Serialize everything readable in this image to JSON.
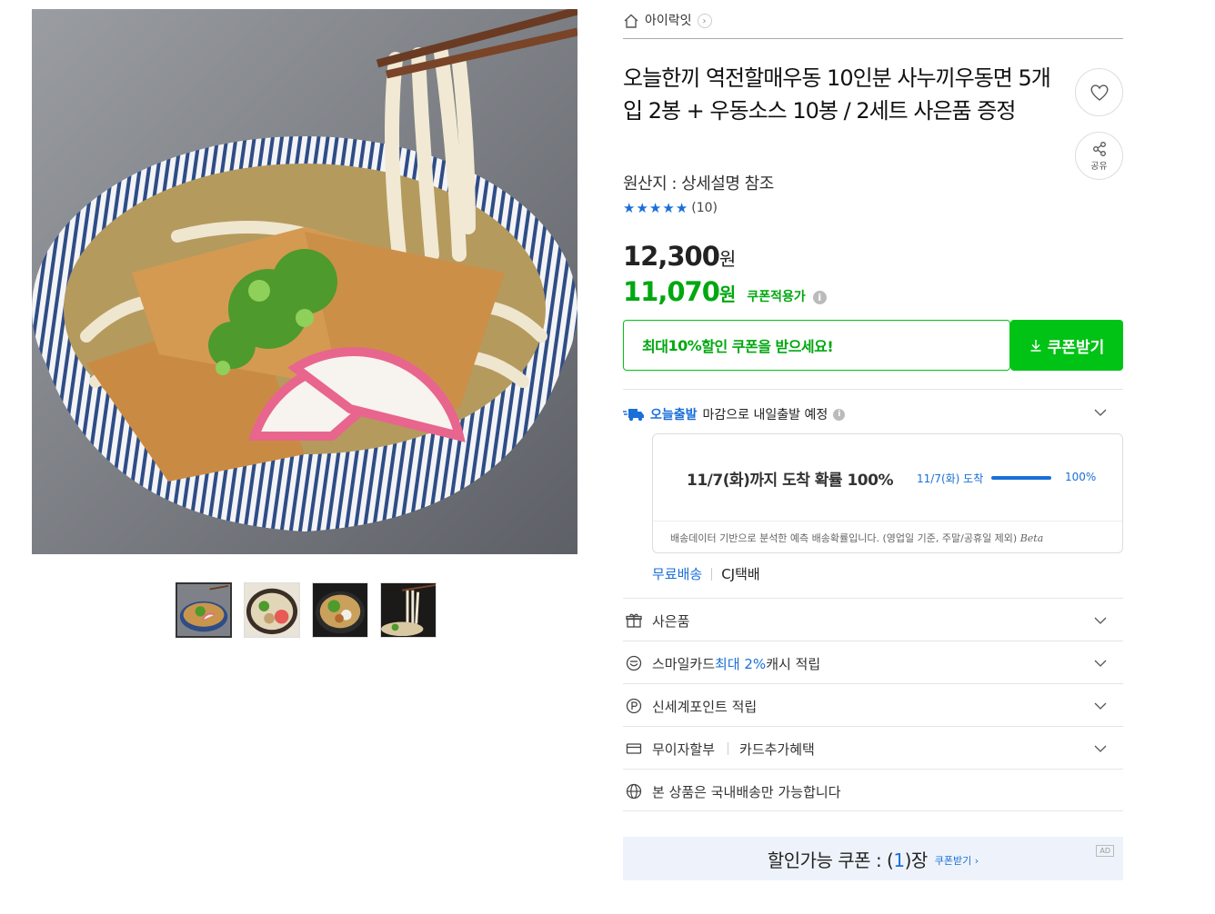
{
  "breadcrumb": {
    "shop_name": "아이락잇",
    "chevron": "›"
  },
  "product": {
    "title": "오늘한끼 역전할매우동 10인분 사누끼우동면 5개입 2봉 + 우동소스 10봉 / 2세트 사은품 증정",
    "origin": "원산지 : 상세설명 참조",
    "rating": {
      "stars": 5,
      "star_glyph": "★",
      "review_count": "(10)"
    },
    "price_original": "12,300",
    "price_original_unit": "원",
    "price_sale": "11,070",
    "price_sale_unit": "원",
    "coupon_applied_label": "쿠폰적용가",
    "info_glyph": "i"
  },
  "actions": {
    "share_label": "공유"
  },
  "coupon": {
    "prompt_prefix": "최대 ",
    "prompt_bold": "10%",
    "prompt_suffix": " 할인 쿠폰을 받으세요!",
    "button_label": "쿠폰받기"
  },
  "shipping": {
    "today_label": "오늘출발",
    "today_text": "마감으로 내일출발 예정",
    "probability_title": "11/7(화)까지 도착 확률 100%",
    "probability_date": "11/7(화) 도착",
    "probability_value": 1.0,
    "probability_pct": "100%",
    "disclaimer": "배송데이터 기반으로 분석한 예측 배송확률입니다. (영업일 기준, 주말/공휴일 제외)",
    "beta": "Beta",
    "free_label": "무료배송",
    "courier": "CJ택배"
  },
  "accordion": {
    "gift": "사은품",
    "smile_prefix": "스마일카드 ",
    "smile_highlight": "최대 2%",
    "smile_suffix": " 캐시 적립",
    "points": "신세계포인트 적립",
    "installment": "무이자할부",
    "card_benefit": "카드추가혜택",
    "domestic": "본 상품은 국내배송만 가능합니다"
  },
  "coupon_banner": {
    "text_prefix": "할인가능 쿠폰 : (",
    "count": "1",
    "text_suffix": ")장",
    "link": "쿠폰받기 ›",
    "ad": "AD"
  },
  "colors": {
    "accent_green": "#00c316",
    "accent_blue": "#1a6fd8"
  },
  "icons": [
    "home-icon",
    "heart-icon",
    "share-icon",
    "truck-icon",
    "gift-icon",
    "smile-icon",
    "point-icon",
    "card-icon",
    "globe-icon",
    "download-icon",
    "chevron-down-icon"
  ]
}
